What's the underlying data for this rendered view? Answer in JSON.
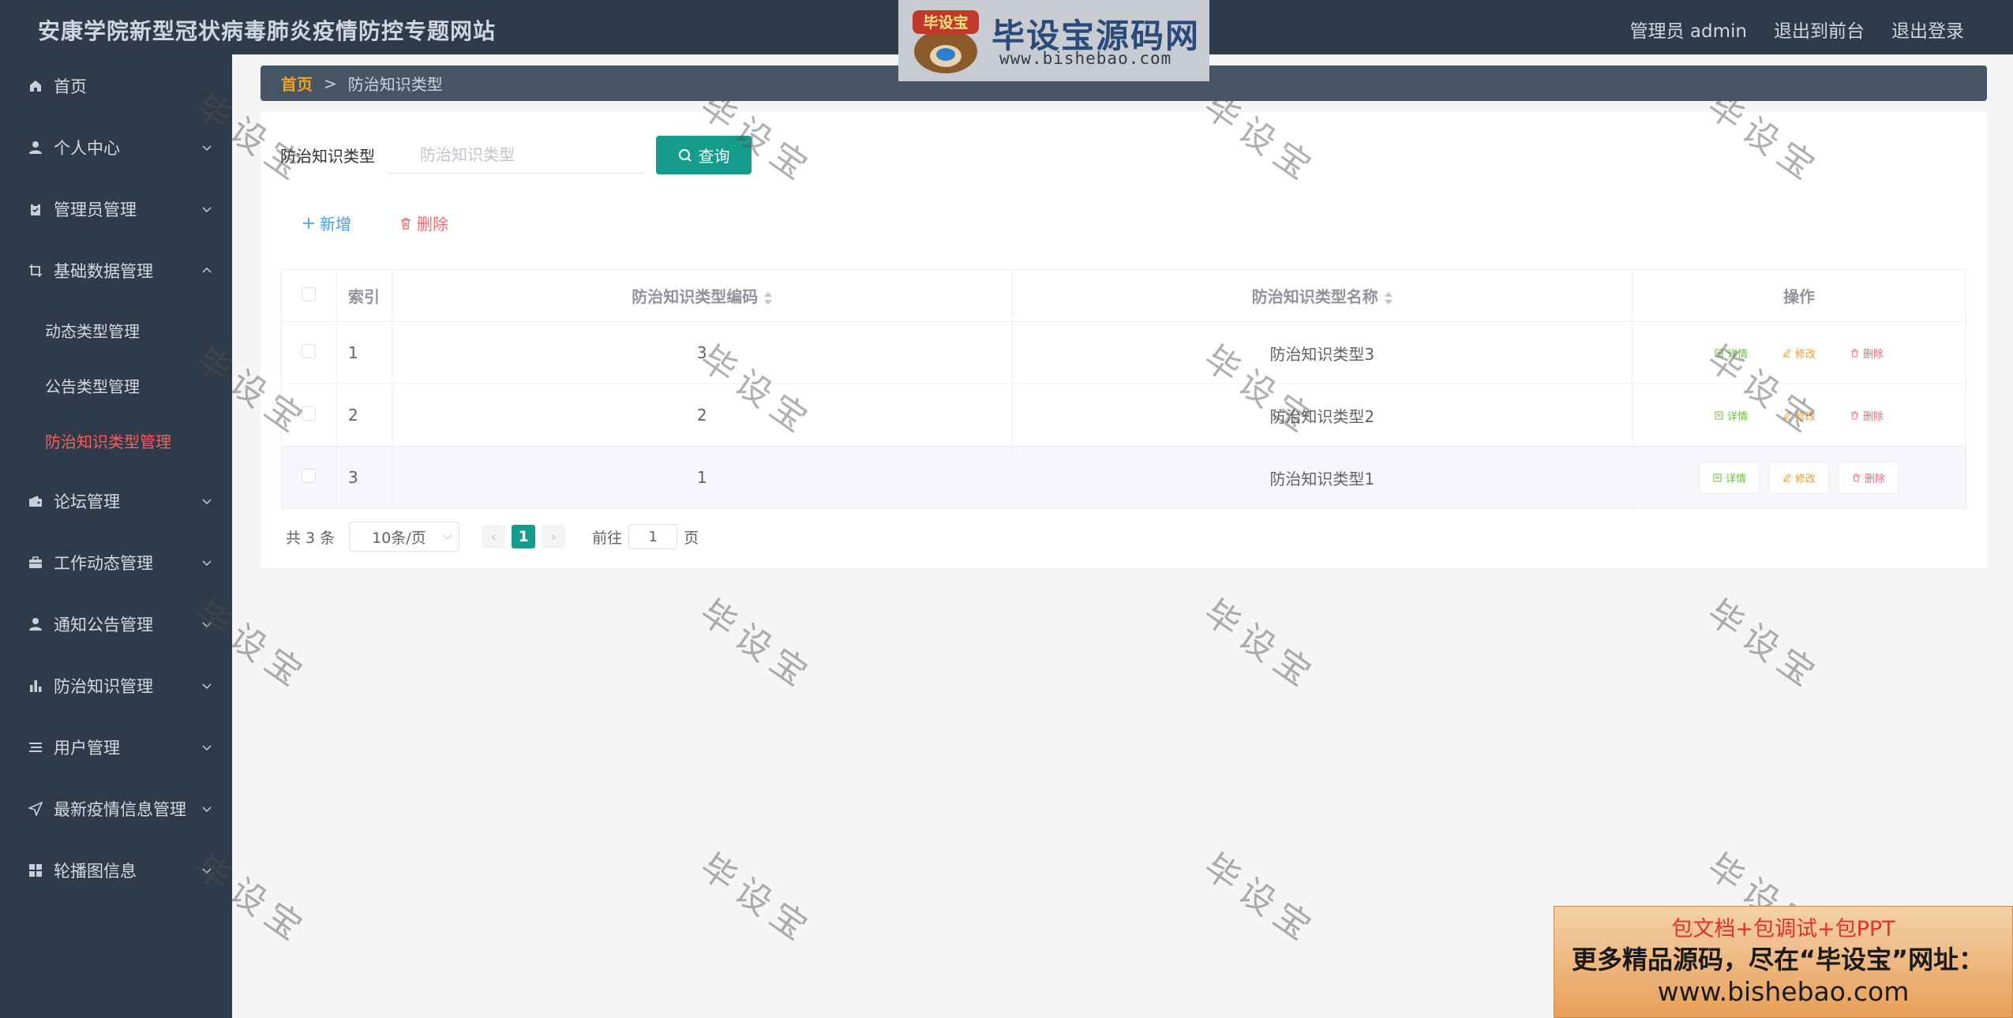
{
  "header": {
    "site_title": "安康学院新型冠状病毒肺炎疫情防控专题网站",
    "user_label": "管理员 admin",
    "to_front_label": "退出到前台",
    "logout_label": "退出登录"
  },
  "logo": {
    "badge": "毕设宝",
    "text": "毕设宝源码网",
    "url": "www.bishebao.com"
  },
  "sidebar": {
    "items": [
      {
        "label": "首页",
        "icon": "home-icon"
      },
      {
        "label": "个人中心",
        "icon": "user-icon"
      },
      {
        "label": "管理员管理",
        "icon": "clipboard-icon"
      },
      {
        "label": "基础数据管理",
        "icon": "crop-icon"
      },
      {
        "label": "论坛管理",
        "icon": "wallet-icon"
      },
      {
        "label": "工作动态管理",
        "icon": "briefcase-icon"
      },
      {
        "label": "通知公告管理",
        "icon": "user-icon"
      },
      {
        "label": "防治知识管理",
        "icon": "bar-chart-icon"
      },
      {
        "label": "用户管理",
        "icon": "list-icon"
      },
      {
        "label": "最新疫情信息管理",
        "icon": "send-icon"
      },
      {
        "label": "轮播图信息",
        "icon": "grid-icon"
      }
    ],
    "submenu": [
      {
        "label": "动态类型管理"
      },
      {
        "label": "公告类型管理"
      },
      {
        "label": "防治知识类型管理"
      }
    ]
  },
  "breadcrumb": {
    "home": "首页",
    "separator": ">",
    "current": "防治知识类型"
  },
  "search": {
    "label": "防治知识类型",
    "placeholder": "防治知识类型",
    "button_label": "查询"
  },
  "actions": {
    "add_label": "新增",
    "delete_label": "删除"
  },
  "table": {
    "headers": [
      "索引",
      "防治知识类型编码",
      "防治知识类型名称",
      "操作"
    ],
    "rows": [
      {
        "index": "1",
        "code": "3",
        "name": "防治知识类型3"
      },
      {
        "index": "2",
        "code": "2",
        "name": "防治知识类型2"
      },
      {
        "index": "3",
        "code": "1",
        "name": "防治知识类型1"
      }
    ],
    "op_labels": {
      "view": "详情",
      "edit": "修改",
      "delete": "删除"
    }
  },
  "pagination": {
    "total": "共 3 条",
    "page_size": "10条/页",
    "current_page": "1",
    "goto_label": "前往",
    "goto_value": "1",
    "page_unit": "页"
  },
  "watermark_text": "毕设宝",
  "ad": {
    "line1": "包文档+包调试+包PPT",
    "line2": "更多精品源码，尽在“毕设宝”网址：",
    "line3": "www.bishebao.com"
  },
  "colors": {
    "header_bg": "#2f3b4a",
    "primary": "#159c8c",
    "active_menu": "#ff5b5b",
    "breadcrumb_home": "#f0a020"
  }
}
